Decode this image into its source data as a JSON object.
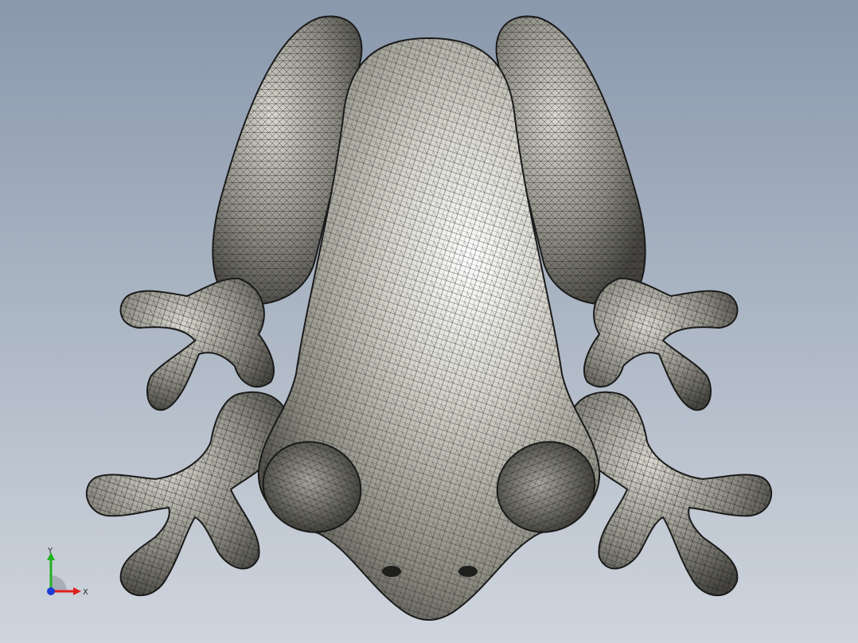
{
  "viewport": {
    "background_top": "#8a98ad",
    "background_bottom": "#cfd5dd"
  },
  "model": {
    "subject": "frog-mesh",
    "display_mode": "shaded-with-edges",
    "surface_color": "#b9b8ae",
    "edge_color": "#1a1a1a"
  },
  "triad": {
    "x_label": "X",
    "y_label": "Y",
    "x_color": "#e0201c",
    "y_color": "#22b022",
    "z_color": "#1d3bd6"
  }
}
